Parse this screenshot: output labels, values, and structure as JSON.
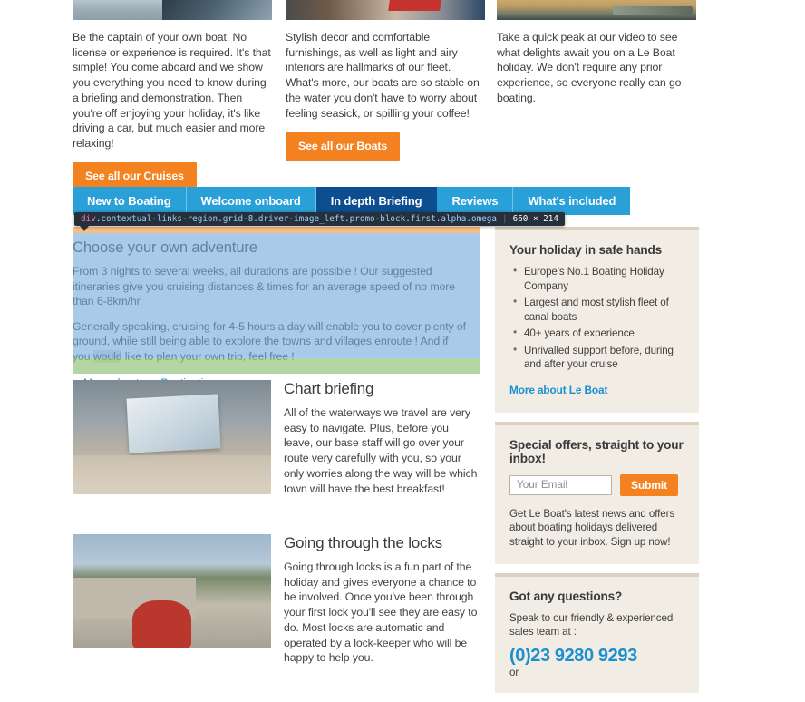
{
  "promos": [
    {
      "image_name": "boat-on-water-photo",
      "body": "Be the captain of your own boat. No license or experience is required. It's that simple!  You come aboard and we show you everything you need to know during a briefing and demonstration.  Then you're off enjoying your holiday, it's like driving a car, but much easier and more relaxing!",
      "cta": "See all our Cruises"
    },
    {
      "image_name": "boat-interior-photo",
      "body": "Stylish decor and comfortable furnishings, as well as light and airy interiors are hallmarks of our fleet. What's more, our boats are so stable on the water you don't have to worry about feeling seasick, or spilling your coffee!",
      "cta": "See all our Boats"
    },
    {
      "image_name": "video-thumbnail",
      "body": "Take a quick peak at our video to see what delights await you on a Le Boat holiday. We don't require any prior experience, so everyone really can go boating.",
      "cta": null
    }
  ],
  "tabs": [
    {
      "label": "New to Boating",
      "active": false
    },
    {
      "label": "Welcome onboard",
      "active": false
    },
    {
      "label": "In depth Briefing",
      "active": true
    },
    {
      "label": "Reviews",
      "active": false
    },
    {
      "label": "What's included",
      "active": false
    }
  ],
  "devtools": {
    "tag": "div",
    "classes": ".contextual-links-region.grid-8.driver-image_left.promo-block.first.alpha.omega",
    "dimensions": "660 × 214"
  },
  "adventure": {
    "title": "Choose your own adventure",
    "paragraph_1": "From 3 nights to several weeks, all durations are possible ! Our suggested itineraries give you cruising distances & times for an average speed of no more than 6-8km/hr.",
    "paragraph_2_a": "Generally speaking, cruising for 4-5 hours a day will enable you to cover plenty of ground, while still being able to explore the towns and villages enroute ! And if you ",
    "paragraph_2_highlight": "would",
    "paragraph_2_b": " like to plan your own trip, feel free !",
    "link": "More about our Destinations"
  },
  "articles": [
    {
      "image_name": "chart-briefing-photo",
      "title": "Chart briefing",
      "body": "All of the waterways we travel are very easy to navigate.  Plus, before you leave, our base staff will go over your route very carefully with you, so your only worries along the way will be which town will have the best breakfast!"
    },
    {
      "image_name": "going-through-locks-photo",
      "title": "Going through the locks",
      "body": "Going through locks is a fun part of the holiday and gives everyone a chance to be involved. Once you've been through your first lock you'll see they are easy to do. Most locks are automatic and operated by a lock-keeper who will be happy to help you."
    }
  ],
  "sidebar": {
    "safe_hands": {
      "title": "Your holiday in safe hands",
      "items": [
        "Europe's No.1 Boating Holiday Company",
        "Largest and most stylish fleet of canal boats",
        "40+ years of experience",
        "Unrivalled support before, during and after your cruise"
      ],
      "link": "More about Le Boat"
    },
    "newsletter": {
      "title": "Special offers, straight to your inbox!",
      "email_placeholder": "Your Email",
      "email_value": "",
      "submit_label": "Submit",
      "description": "Get Le Boat's latest news and offers about boating holidays delivered straight to your inbox. Sign up now!"
    },
    "questions": {
      "title": "Got any questions?",
      "intro": "Speak to our friendly & experienced sales team at :",
      "phone": "(0)23 9280 9293",
      "or": "or"
    }
  },
  "colors": {
    "orange": "#f58220",
    "tab_blue": "#29a0d8",
    "tab_active_blue": "#0c4e8f",
    "link_blue": "#1a8fd0",
    "sidebar_bg": "#f2ede4"
  }
}
